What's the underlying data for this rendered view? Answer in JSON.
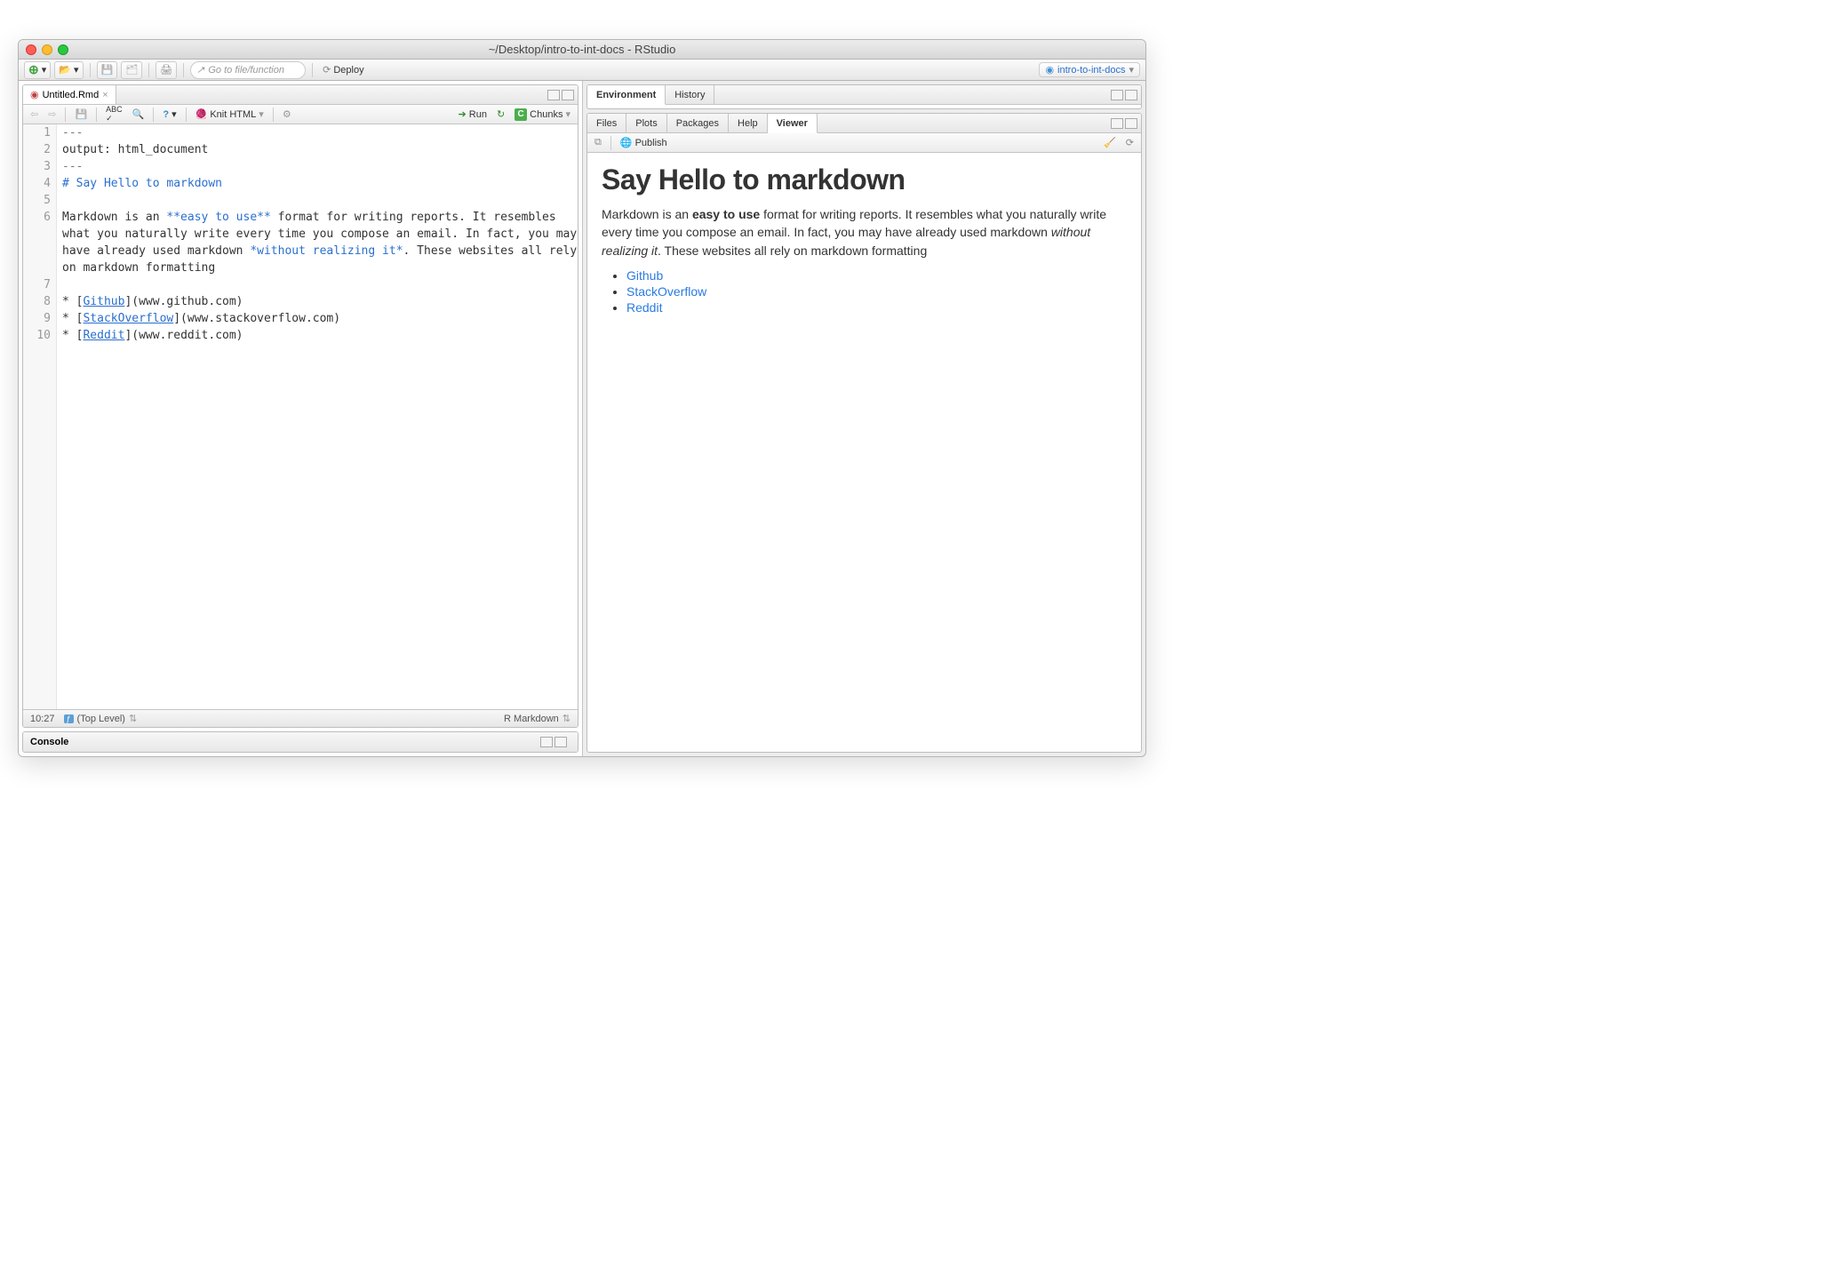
{
  "window": {
    "title": "~/Desktop/intro-to-int-docs - RStudio"
  },
  "mainToolbar": {
    "searchPlaceholder": "Go to file/function",
    "deploy": "Deploy",
    "project": "intro-to-int-docs"
  },
  "source": {
    "tabName": "Untitled.Rmd",
    "knit": "Knit HTML",
    "run": "Run",
    "chunks": "Chunks",
    "lines": {
      "1": "---",
      "2": "output: html_document",
      "3": "---",
      "4": "# Say Hello to markdown",
      "5": "",
      "6": "Markdown is an **easy to use** format for writing reports. It resembles what you naturally write every time you compose an email. In fact, you may have already used markdown *without realizing it*. These websites all rely on markdown formatting",
      "7": "",
      "8a": "* [",
      "8b": "Github",
      "8c": "](www.github.com)",
      "9a": "* [",
      "9b": "StackOverflow",
      "9c": "](www.stackoverflow.com)",
      "10a": "* [",
      "10b": "Reddit",
      "10c": "](www.reddit.com)"
    },
    "status": {
      "pos": "10:27",
      "scope": "(Top Level)",
      "lang": "R Markdown"
    }
  },
  "console": {
    "label": "Console"
  },
  "rightTop": {
    "tabs": [
      "Environment",
      "History"
    ]
  },
  "rightBottom": {
    "tabs": [
      "Files",
      "Plots",
      "Packages",
      "Help",
      "Viewer"
    ],
    "publish": "Publish"
  },
  "viewer": {
    "h1": "Say Hello to markdown",
    "p1a": "Markdown is an ",
    "p1b": "easy to use",
    "p1c": " format for writing reports. It resembles what you naturally write every time you compose an email. In fact, you may have already used markdown ",
    "p1d": "without realizing it",
    "p1e": ". These websites all rely on markdown formatting",
    "links": [
      "Github",
      "StackOverflow",
      "Reddit"
    ]
  }
}
